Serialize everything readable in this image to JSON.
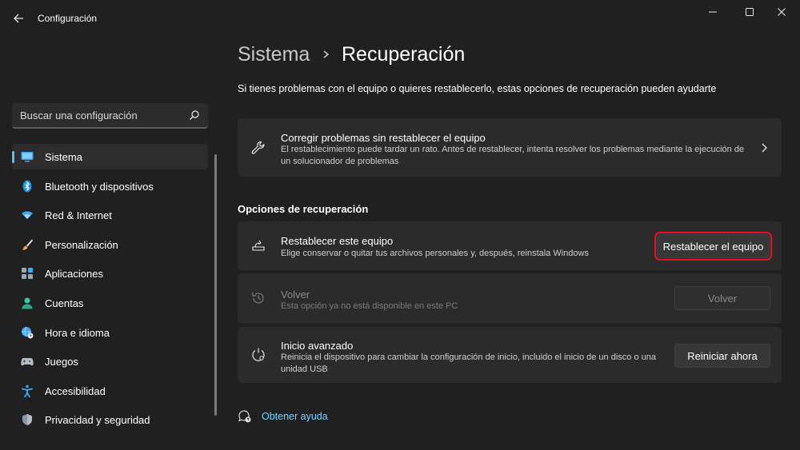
{
  "window": {
    "title": "Configuración",
    "back_icon": "arrow-left-icon",
    "controls": [
      "minimize-icon",
      "maximize-icon",
      "close-icon"
    ]
  },
  "search": {
    "placeholder": "Buscar una configuración",
    "icon": "search-icon"
  },
  "sidebar": {
    "items": [
      {
        "label": "Sistema",
        "icon": "monitor-icon",
        "active": true
      },
      {
        "label": "Bluetooth y dispositivos",
        "icon": "bluetooth-icon"
      },
      {
        "label": "Red & Internet",
        "icon": "wifi-icon"
      },
      {
        "label": "Personalización",
        "icon": "brush-icon"
      },
      {
        "label": "Aplicaciones",
        "icon": "apps-icon"
      },
      {
        "label": "Cuentas",
        "icon": "person-icon"
      },
      {
        "label": "Hora e idioma",
        "icon": "globe-clock-icon"
      },
      {
        "label": "Juegos",
        "icon": "gamepad-icon"
      },
      {
        "label": "Accesibilidad",
        "icon": "accessibility-icon"
      },
      {
        "label": "Privacidad y seguridad",
        "icon": "shield-icon"
      }
    ]
  },
  "breadcrumb": {
    "parent": "Sistema",
    "current": "Recuperación"
  },
  "description": "Si tienes problemas con el equipo o quieres restablecerlo, estas opciones de recuperación pueden ayudarte",
  "troubleshoot": {
    "title": "Corregir problemas sin restablecer el equipo",
    "subtitle": "El restablecimiento puede tardar un rato. Antes de restablecer, intenta resolver los problemas mediante la ejecución de un solucionador de problemas",
    "icon": "wrench-icon"
  },
  "section_title": "Opciones de recuperación",
  "options": {
    "reset": {
      "title": "Restablecer este equipo",
      "subtitle": "Elige conservar o quitar tus archivos personales y, después, reinstala Windows",
      "button": "Restablecer el equipo",
      "icon": "reset-pc-icon"
    },
    "goback": {
      "title": "Volver",
      "subtitle": "Esta opción ya no está disponible en este PC",
      "button": "Volver",
      "icon": "history-icon"
    },
    "advanced": {
      "title": "Inicio avanzado",
      "subtitle": "Reinicia el dispositivo para cambiar la configuración de inicio, incluido el inicio de un disco o una unidad USB",
      "button": "Reiniciar ahora",
      "icon": "advanced-startup-icon"
    }
  },
  "help": {
    "label": "Obtener ayuda",
    "icon": "help-chat-icon"
  },
  "colors": {
    "accent": "#4cc2ff",
    "highlight_outline": "#e81123",
    "background": "#202020",
    "card": "#2b2b2b"
  }
}
